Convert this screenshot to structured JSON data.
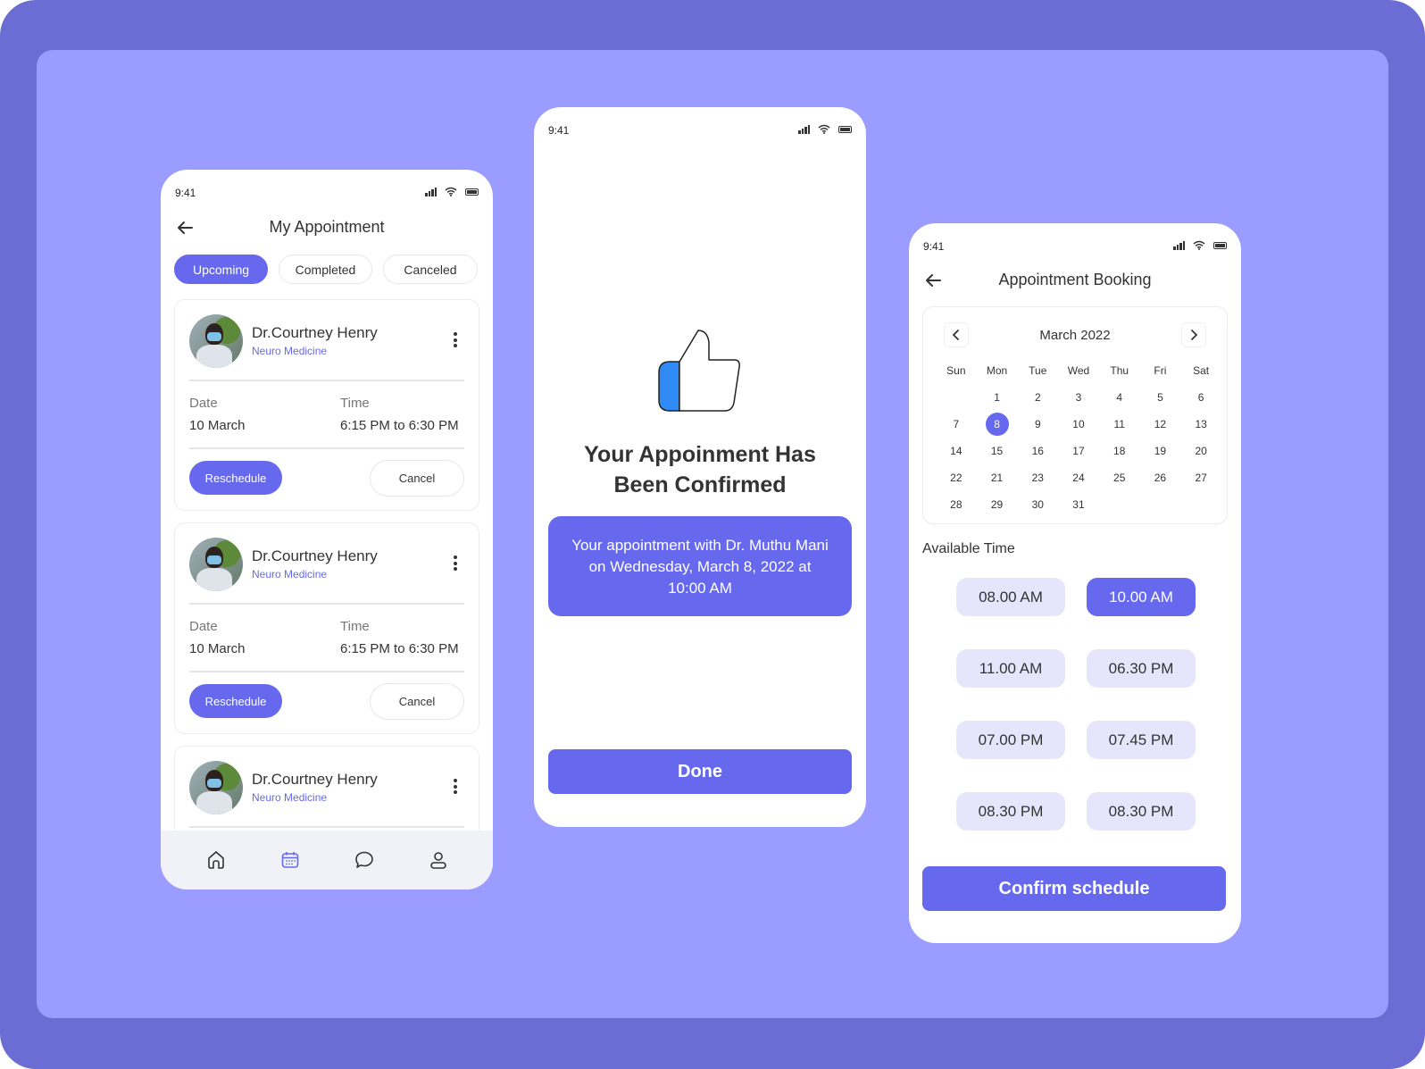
{
  "colors": {
    "frame": "#6b6dd4",
    "canvas": "#9a9dff",
    "accent": "#6669ee",
    "slot_bg": "#e7e5fb",
    "thumb_fill": "#2f8af5"
  },
  "status_bar": {
    "time": "9:41",
    "icons": [
      "signal-icon",
      "wifi-icon",
      "battery-icon"
    ]
  },
  "my_appointment": {
    "title": "My Appointment",
    "tabs": [
      {
        "label": "Upcoming",
        "active": true
      },
      {
        "label": "Completed",
        "active": false
      },
      {
        "label": "Canceled",
        "active": false
      }
    ],
    "cards": [
      {
        "name": "Dr.Courtney Henry",
        "specialty": "Neuro Medicine",
        "date_label": "Date",
        "date": "10 March",
        "time_label": "Time",
        "time": "6:15 PM to 6:30 PM",
        "reschedule": "Reschedule",
        "cancel": "Cancel"
      },
      {
        "name": "Dr.Courtney Henry",
        "specialty": "Neuro Medicine",
        "date_label": "Date",
        "date": "10 March",
        "time_label": "Time",
        "time": "6:15 PM to 6:30 PM",
        "reschedule": "Reschedule",
        "cancel": "Cancel"
      },
      {
        "name": "Dr.Courtney Henry",
        "specialty": "Neuro Medicine"
      }
    ],
    "bottom_nav": [
      {
        "icon": "home-icon",
        "active": false
      },
      {
        "icon": "calendar-icon",
        "active": true
      },
      {
        "icon": "chat-icon",
        "active": false
      },
      {
        "icon": "profile-icon",
        "active": false
      }
    ]
  },
  "confirmation": {
    "title_line1": "Your Appoinment Has",
    "title_line2": "Been Confirmed",
    "message": "Your appointment with Dr. Muthu Mani on Wednesday, March 8, 2022 at 10:00 AM",
    "done_label": "Done"
  },
  "booking": {
    "title": "Appointment Booking",
    "calendar": {
      "month": "March 2022",
      "weekdays": [
        "Sun",
        "Mon",
        "Tue",
        "Wed",
        "Thu",
        "Fri",
        "Sat"
      ],
      "weeks": [
        [
          "",
          "1",
          "2",
          "3",
          "4",
          "5",
          "6"
        ],
        [
          "7",
          "8",
          "9",
          "10",
          "11",
          "12",
          "13"
        ],
        [
          "14",
          "15",
          "16",
          "17",
          "18",
          "19",
          "20"
        ],
        [
          "22",
          "21",
          "23",
          "24",
          "25",
          "26",
          "27"
        ],
        [
          "28",
          "29",
          "30",
          "31",
          "",
          "",
          ""
        ]
      ],
      "selected_day": "8"
    },
    "available_label": "Available Time",
    "slots": [
      {
        "label": "08.00 AM",
        "selected": false
      },
      {
        "label": "10.00 AM",
        "selected": true
      },
      {
        "label": "11.00 AM",
        "selected": false
      },
      {
        "label": "06.30 PM",
        "selected": false
      },
      {
        "label": "07.00 PM",
        "selected": false
      },
      {
        "label": "07.45 PM",
        "selected": false
      },
      {
        "label": "08.30 PM",
        "selected": false
      },
      {
        "label": "08.30 PM",
        "selected": false
      }
    ],
    "confirm_label": "Confirm schedule"
  }
}
